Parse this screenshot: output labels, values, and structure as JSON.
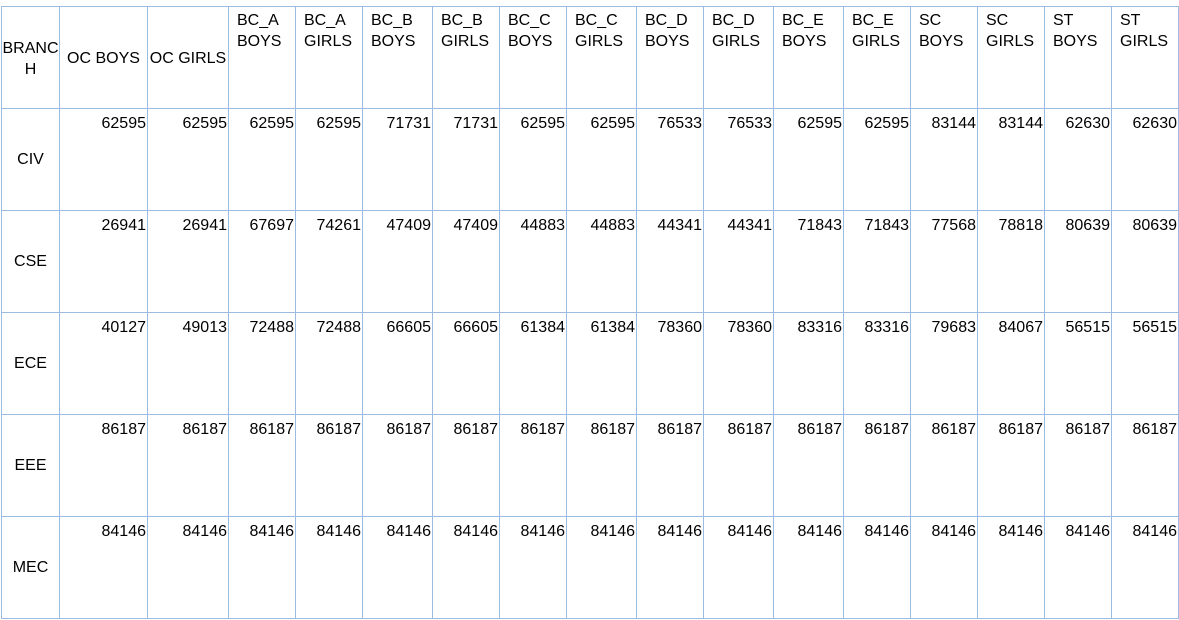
{
  "table": {
    "branch_header": "BRANCH",
    "columns": [
      "OC BOYS",
      "OC GIRLS",
      "BC_A\nBOYS",
      "BC_A\nGIRLS",
      "BC_B\nBOYS",
      "BC_B\nGIRLS",
      "BC_C\nBOYS",
      "BC_C\nGIRLS",
      "BC_D\nBOYS",
      "BC_D\nGIRLS",
      "BC_E\nBOYS",
      "BC_E\nGIRLS",
      "SC\nBOYS",
      "SC\nGIRLS",
      "ST\nBOYS",
      "ST\nGIRLS"
    ],
    "rows": [
      {
        "branch": "CIV",
        "values": [
          "62595",
          "62595",
          "62595",
          "62595",
          "71731",
          "71731",
          "62595",
          "62595",
          "76533",
          "76533",
          "62595",
          "62595",
          "83144",
          "83144",
          "62630",
          "62630"
        ]
      },
      {
        "branch": "CSE",
        "values": [
          "26941",
          "26941",
          "67697",
          "74261",
          "47409",
          "47409",
          "44883",
          "44883",
          "44341",
          "44341",
          "71843",
          "71843",
          "77568",
          "78818",
          "80639",
          "80639"
        ]
      },
      {
        "branch": "ECE",
        "values": [
          "40127",
          "49013",
          "72488",
          "72488",
          "66605",
          "66605",
          "61384",
          "61384",
          "78360",
          "78360",
          "83316",
          "83316",
          "79683",
          "84067",
          "56515",
          "56515"
        ]
      },
      {
        "branch": "EEE",
        "values": [
          "86187",
          "86187",
          "86187",
          "86187",
          "86187",
          "86187",
          "86187",
          "86187",
          "86187",
          "86187",
          "86187",
          "86187",
          "86187",
          "86187",
          "86187",
          "86187"
        ]
      },
      {
        "branch": "MEC",
        "values": [
          "84146",
          "84146",
          "84146",
          "84146",
          "84146",
          "84146",
          "84146",
          "84146",
          "84146",
          "84146",
          "84146",
          "84146",
          "84146",
          "84146",
          "84146",
          "84146"
        ]
      }
    ]
  }
}
